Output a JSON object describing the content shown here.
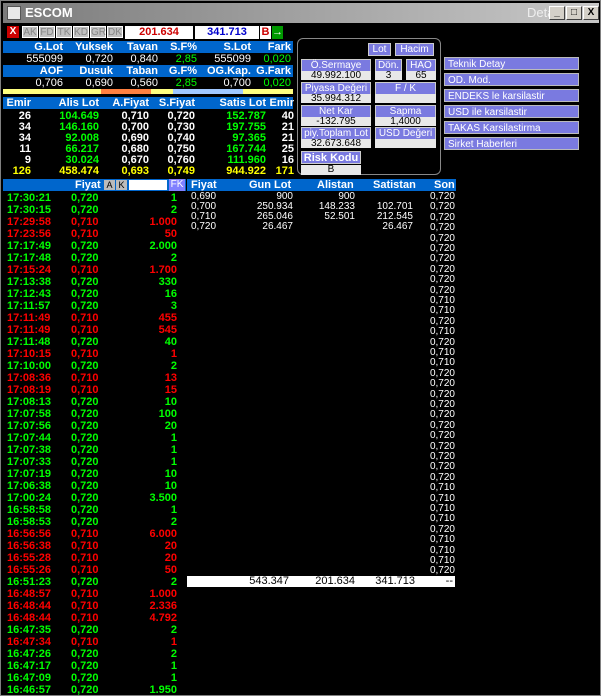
{
  "window": {
    "title": "ESCOM",
    "title_right": "Detay",
    "min": "_",
    "max": "□",
    "close": "X"
  },
  "toolbar": {
    "close": "X",
    "tabs": [
      "AK",
      "FD",
      "TK",
      "KD",
      "GR",
      "DK"
    ],
    "val1": "201.634",
    "val2": "341.713",
    "b": "B",
    "arrow": "→"
  },
  "summary": {
    "h1": [
      "G.Lot",
      "Yuksek",
      "Tavan",
      "S.F%",
      "S.Lot",
      "Fark"
    ],
    "v1": [
      "555099",
      "0,720",
      "0,840",
      "2,85",
      "555099",
      "0,020"
    ],
    "h2": [
      "AOF",
      "Dusuk",
      "Taban",
      "G.F%",
      "OG.Kap.",
      "G.Fark"
    ],
    "v2": [
      "0,706",
      "0,690",
      "0,560",
      "2,85",
      "0,700",
      "0,020"
    ]
  },
  "depth": {
    "h": [
      "Emir",
      "Alis Lot",
      "A.Fiyat",
      "S.Fiyat",
      "Satis Lot",
      "Emir"
    ],
    "rows": [
      [
        "26",
        "104.649",
        "0,710",
        "0,720",
        "152.787",
        "40"
      ],
      [
        "34",
        "146.160",
        "0,700",
        "0,730",
        "197.755",
        "21"
      ],
      [
        "34",
        "92.008",
        "0,690",
        "0,740",
        "97.365",
        "21"
      ],
      [
        "11",
        "66.217",
        "0,680",
        "0,750",
        "167.744",
        "25"
      ],
      [
        "9",
        "30.024",
        "0,670",
        "0,760",
        "111.960",
        "16"
      ],
      [
        "126",
        "458.474",
        "0,693",
        "0,749",
        "944.922",
        "171"
      ]
    ]
  },
  "info": {
    "lot": "Lot",
    "hacim": "Hacim",
    "osermaye": "Ö.Sermaye",
    "osermaye_v": "49.992.100",
    "don": "Dön.",
    "don_v": "3",
    "hao": "HAO",
    "hao_v": "65",
    "piyasa": "Piyasa Değeri",
    "piyasa_v": "35.994.312",
    "fk": "F / K",
    "fk_v": "",
    "netkar": "Net Kar",
    "netkar_v": "-132.795",
    "sapma": "Sapma",
    "sapma_v": "1,4000",
    "piytoplam": "piy.Toplam Lot",
    "piytoplam_v": "32.673.648",
    "usd": "USD Değeri",
    "usd_v": "",
    "risk": "Risk Kodu",
    "risk_v": "B"
  },
  "menu": [
    "Teknik Detay",
    "OD. Mod.",
    "ENDEKS le karsilastir",
    "USD ile karsilastir",
    "TAKAS Karsilastirma",
    "Sirket Haberleri"
  ],
  "ticks_header": {
    "fiyat": "Fiyat",
    "a": "A",
    "k": "K",
    "fk": "FK"
  },
  "ticks": [
    [
      "17:30:21",
      "0,720",
      "1",
      "g"
    ],
    [
      "17:30:15",
      "0,720",
      "2",
      "g"
    ],
    [
      "17:29:58",
      "0,710",
      "1.000",
      "r"
    ],
    [
      "17:23:56",
      "0,710",
      "50",
      "r"
    ],
    [
      "17:17:49",
      "0,720",
      "2.000",
      "g"
    ],
    [
      "17:17:48",
      "0,720",
      "2",
      "g"
    ],
    [
      "17:15:24",
      "0,710",
      "1.700",
      "r"
    ],
    [
      "17:13:38",
      "0,720",
      "330",
      "g"
    ],
    [
      "17:12:43",
      "0,720",
      "16",
      "g"
    ],
    [
      "17:11:57",
      "0,720",
      "3",
      "g"
    ],
    [
      "17:11:49",
      "0,710",
      "455",
      "r"
    ],
    [
      "17:11:49",
      "0,710",
      "545",
      "r"
    ],
    [
      "17:11:48",
      "0,720",
      "40",
      "g"
    ],
    [
      "17:10:15",
      "0,710",
      "1",
      "r"
    ],
    [
      "17:10:00",
      "0,720",
      "2",
      "g"
    ],
    [
      "17:08:36",
      "0,710",
      "13",
      "r"
    ],
    [
      "17:08:19",
      "0,710",
      "15",
      "r"
    ],
    [
      "17:08:13",
      "0,720",
      "10",
      "g"
    ],
    [
      "17:07:58",
      "0,720",
      "100",
      "g"
    ],
    [
      "17:07:56",
      "0,720",
      "20",
      "g"
    ],
    [
      "17:07:44",
      "0,720",
      "1",
      "g"
    ],
    [
      "17:07:38",
      "0,720",
      "1",
      "g"
    ],
    [
      "17:07:33",
      "0,720",
      "1",
      "g"
    ],
    [
      "17:07:19",
      "0,720",
      "10",
      "g"
    ],
    [
      "17:06:38",
      "0,720",
      "10",
      "g"
    ],
    [
      "17:00:24",
      "0,720",
      "3.500",
      "g"
    ],
    [
      "16:58:58",
      "0,720",
      "1",
      "g"
    ],
    [
      "16:58:53",
      "0,720",
      "2",
      "g"
    ],
    [
      "16:56:56",
      "0,710",
      "6.000",
      "r"
    ],
    [
      "16:56:38",
      "0,710",
      "20",
      "r"
    ],
    [
      "16:55:28",
      "0,710",
      "20",
      "r"
    ],
    [
      "16:55:26",
      "0,710",
      "50",
      "r"
    ],
    [
      "16:51:23",
      "0,720",
      "2",
      "g"
    ],
    [
      "16:48:57",
      "0,710",
      "1.000",
      "r"
    ],
    [
      "16:48:44",
      "0,710",
      "2.336",
      "r"
    ],
    [
      "16:48:44",
      "0,710",
      "4.792",
      "r"
    ],
    [
      "16:47:35",
      "0,720",
      "2",
      "g"
    ],
    [
      "16:47:34",
      "0,710",
      "1",
      "r"
    ],
    [
      "16:47:26",
      "0,720",
      "2",
      "g"
    ],
    [
      "16:47:17",
      "0,720",
      "1",
      "g"
    ],
    [
      "16:47:09",
      "0,720",
      "1",
      "g"
    ],
    [
      "16:46:57",
      "0,720",
      "1.950",
      "g"
    ]
  ],
  "dist_header": {
    "fiyat": "Fiyat",
    "gunlot": "Gun Lot",
    "alistan": "Alistan",
    "satistan": "Satistan",
    "son": "Son"
  },
  "dist": [
    [
      "0,690",
      "900",
      "900",
      ""
    ],
    [
      "0,700",
      "250.934",
      "148.233",
      "102.701"
    ],
    [
      "0,710",
      "265.046",
      "52.501",
      "212.545"
    ],
    [
      "0,720",
      "26.467",
      "",
      "26.467"
    ]
  ],
  "son": [
    "0,720",
    "0,720",
    "0,720",
    "0,720",
    "0,720",
    "0,720",
    "0,720",
    "0,720",
    "0,720",
    "0,720",
    "0,710",
    "0,710",
    "0,720",
    "0,710",
    "0,720",
    "0,710",
    "0,710",
    "0,720",
    "0,720",
    "0,720",
    "0,720",
    "0,720",
    "0,720",
    "0,720",
    "0,720",
    "0,720",
    "0,720",
    "0,720",
    "0,710",
    "0,710",
    "0,710",
    "0,710",
    "0,720",
    "0,710",
    "0,710",
    "0,710",
    "0,720"
  ],
  "sum": {
    "gunlot": "543.347",
    "alistan": "201.634",
    "satistan": "341.713",
    "son": "--"
  }
}
